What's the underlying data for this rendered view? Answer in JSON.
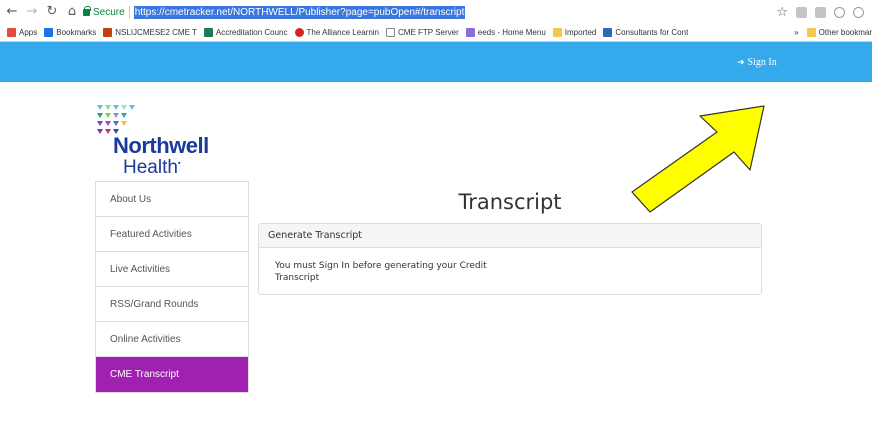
{
  "browser": {
    "secure_label": "Secure",
    "url": "https://cmetracker.net/NORTHWELL/Publisher?page=pubOpen#/transcript",
    "bookmarks": [
      {
        "label": "Apps",
        "icon": "apps-grid-icon",
        "color": "#e04b3a"
      },
      {
        "label": "Bookmarks",
        "icon": "star-icon",
        "color": "#1a73e8"
      },
      {
        "label": "NSLIJCMESE2 CME T",
        "icon": "site-icon",
        "color": "#c2410c"
      },
      {
        "label": "Accreditation Counc",
        "icon": "triangle-icon",
        "color": "#1f7a55"
      },
      {
        "label": "The Alliance Learnin",
        "icon": "alliance-icon",
        "color": "#d3261a"
      },
      {
        "label": "CME FTP Server",
        "icon": "page-icon",
        "color": "#888888"
      },
      {
        "label": "eeds - Home Menu",
        "icon": "eeds-icon",
        "color": "#8e6bd8"
      },
      {
        "label": "Imported",
        "icon": "folder-icon",
        "color": "#f2c94c"
      },
      {
        "label": "Consultants for Cont",
        "icon": "site-icon",
        "color": "#2b6cb0"
      }
    ],
    "overflow": "»",
    "other_bookmarks": "Other bookmar"
  },
  "header": {
    "signin_label": "Sign In"
  },
  "logo": {
    "name": "Northwell",
    "sub": "Health"
  },
  "sidebar": {
    "items": [
      {
        "label": "About Us"
      },
      {
        "label": "Featured Activities"
      },
      {
        "label": "Live Activities"
      },
      {
        "label": "RSS/Grand Rounds"
      },
      {
        "label": "Online Activities"
      },
      {
        "label": "CME Transcript"
      }
    ]
  },
  "main": {
    "title": "Transcript",
    "panel_heading": "Generate Transcript",
    "panel_message": "You must Sign In before generating your Credit Transcript"
  },
  "colors": {
    "header": "#34aaec",
    "active_nav": "#a020b0",
    "logo_text": "#1a3a9c",
    "arrow": "#ffff00"
  }
}
